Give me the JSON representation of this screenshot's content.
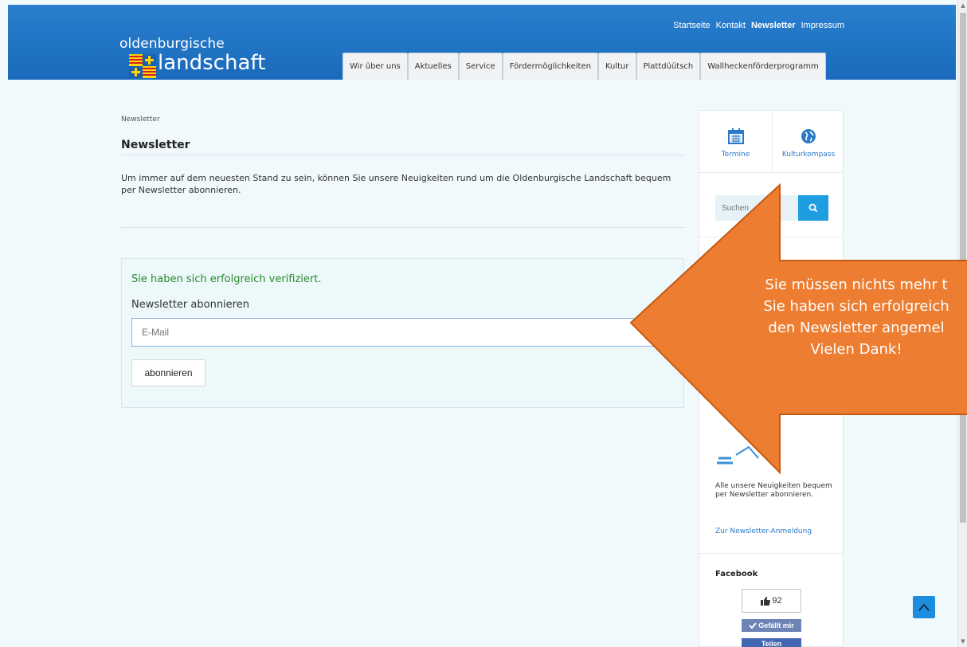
{
  "header": {
    "top_links": [
      "Startseite",
      "Kontakt",
      "Newsletter",
      "Impressum"
    ],
    "logo_line1": "oldenburgische",
    "logo_line2": "landschaft",
    "nav_tabs": [
      "Wir über uns",
      "Aktuelles",
      "Service",
      "Fördermöglichkeiten",
      "Kultur",
      "Plattdüütsch",
      "Wallheckenförderprogramm"
    ]
  },
  "main": {
    "breadcrumb": "Newsletter",
    "title": "Newsletter",
    "intro": "Um immer auf dem neuesten Stand zu sein, können Sie unsere Neuigkeiten rund um die Oldenburgische Landschaft bequem per Newsletter abonnieren.",
    "form": {
      "success": "Sie haben sich erfolgreich verifiziert.",
      "label": "Newsletter abonnieren",
      "email_placeholder": "E-Mail",
      "button": "abonnieren"
    }
  },
  "sidebar": {
    "quick_links": [
      {
        "label": "Termine",
        "icon": "calendar-icon"
      },
      {
        "label": "Kulturkompass",
        "icon": "globe-icon"
      }
    ],
    "search_placeholder": "Suchen",
    "newsletter_text": "Alle unsere Neuigkeiten bequem per Newsletter abonnieren.",
    "newsletter_link": "Zur Newsletter-Anmeldung",
    "facebook": {
      "title": "Facebook",
      "count": "92",
      "like": "Gefällt mir",
      "share": "Teilen"
    }
  },
  "annotation": {
    "lines": [
      "Sie müssen nichts mehr t",
      "Sie haben sich erfolgreich",
      "den Newsletter angemel",
      "Vielen Dank!"
    ]
  },
  "colors": {
    "header_blue": "#1f74c5",
    "accent_blue": "#1e9ee0",
    "success_green": "#2a8a2a",
    "annotation_orange": "#ed7d31"
  }
}
